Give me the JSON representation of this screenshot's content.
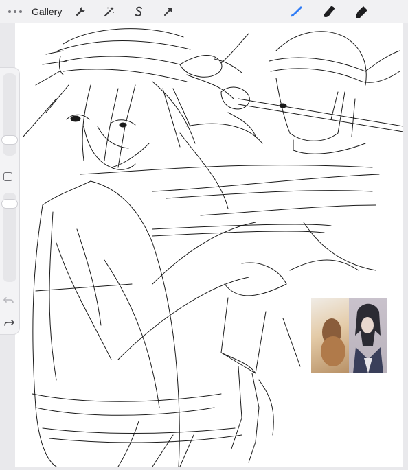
{
  "toolbar": {
    "gallery_label": "Gallery",
    "left_tools": [
      "wrench-icon",
      "magic-wand-icon",
      "selection-s-icon",
      "transform-arrow-icon"
    ],
    "right_tools": [
      "brush-icon",
      "smudge-icon",
      "eraser-icon"
    ],
    "active_tool": "brush-icon",
    "accent_color": "#2f7cf6"
  },
  "sidebar": {
    "controls": [
      "brush-size-slider",
      "modify-square-button",
      "opacity-slider",
      "undo-icon",
      "redo-icon"
    ]
  },
  "reference_panel": {
    "images": [
      "reference-photo-landscape",
      "reference-photo-character"
    ]
  }
}
